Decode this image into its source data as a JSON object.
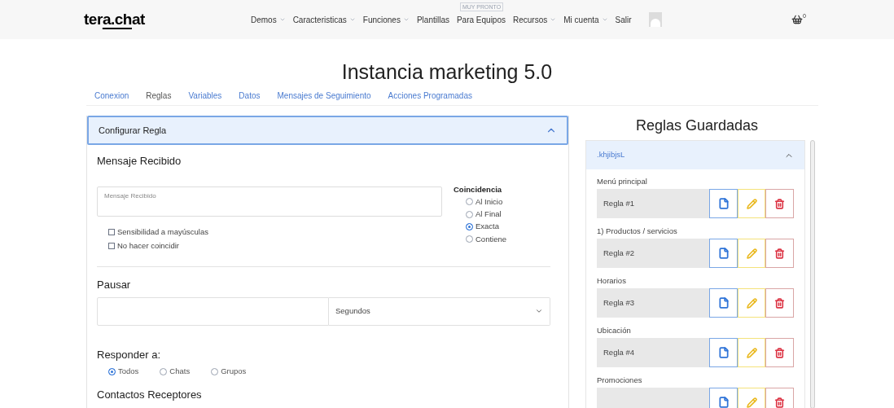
{
  "header": {
    "logo": {
      "before": "ter",
      "underlined": "a.ch",
      "after": "at"
    },
    "nav": [
      {
        "label": "Demos",
        "dropdown": true
      },
      {
        "label": "Caracteristicas",
        "dropdown": true
      },
      {
        "label": "Funciones",
        "dropdown": true
      },
      {
        "label": "Plantillas",
        "dropdown": false
      },
      {
        "label": "Para Equipos",
        "dropdown": false,
        "badge": "MUY PRONTO"
      },
      {
        "label": "Recursos",
        "dropdown": true
      },
      {
        "label": "Mi cuenta",
        "dropdown": true
      },
      {
        "label": "Salir",
        "dropdown": false
      }
    ],
    "cart_count": "0"
  },
  "title": "Instancia marketing 5.0",
  "tabs": [
    {
      "label": "Conexion",
      "selected": false
    },
    {
      "label": "Reglas",
      "selected": true
    },
    {
      "label": "Variables",
      "selected": false
    },
    {
      "label": "Datos",
      "selected": false
    },
    {
      "label": "Mensajes de Seguimiento",
      "selected": false
    },
    {
      "label": "Acciones Programadas",
      "selected": false
    }
  ],
  "config": {
    "header": "Configurar Regla",
    "expanded": true,
    "message_heading": "Mensaje Recibido",
    "message_placeholder": "Mensaje Recibido",
    "options": [
      {
        "label": "Sensibilidad a mayúsculas",
        "checked": false
      },
      {
        "label": "No hacer coincidir",
        "checked": false
      }
    ],
    "match_heading": "Coincidencia",
    "match_options": [
      {
        "label": "Al Inicio",
        "selected": false
      },
      {
        "label": "Al Final",
        "selected": false
      },
      {
        "label": "Exacta",
        "selected": true
      },
      {
        "label": "Contiene",
        "selected": false
      }
    ],
    "pause_heading": "Pausar",
    "pause_unit": "Segundos",
    "reply_heading": "Responder a:",
    "reply_options": [
      {
        "label": "Todos",
        "selected": true
      },
      {
        "label": "Chats",
        "selected": false
      },
      {
        "label": "Grupos",
        "selected": false
      }
    ],
    "contacts_heading": "Contactos Receptores"
  },
  "saved": {
    "title": "Reglas Guardadas",
    "group": ".khjibjsL",
    "expanded": true,
    "rules": [
      {
        "label": "Menú principal",
        "rule": "Regla #1"
      },
      {
        "label": "1) Productos / servicios",
        "rule": "Regla #2"
      },
      {
        "label": "Horarios",
        "rule": "Regla #3"
      },
      {
        "label": "Ubicación",
        "rule": "Regla #4"
      },
      {
        "label": "Promociones"
      }
    ]
  }
}
